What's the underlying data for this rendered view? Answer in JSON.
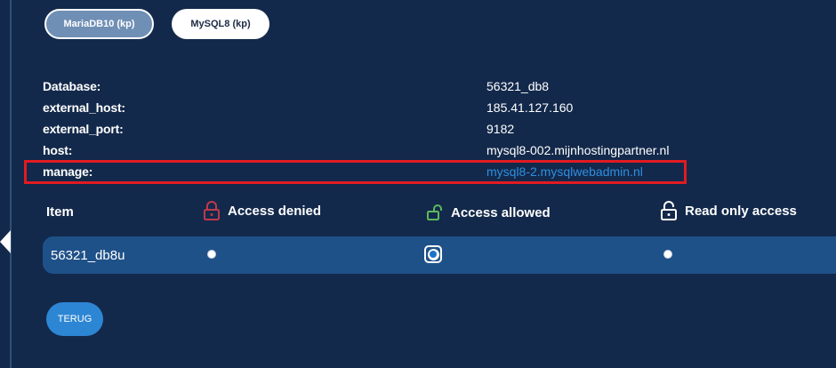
{
  "tabs": [
    {
      "label": "MariaDB10 (kp)",
      "active": true
    },
    {
      "label": "MySQL8 (kp)",
      "active": false
    }
  ],
  "info": {
    "rows": [
      {
        "key": "Database:",
        "value": "56321_db8"
      },
      {
        "key": "external_host:",
        "value": "185.41.127.160"
      },
      {
        "key": "external_port:",
        "value": "9182"
      },
      {
        "key": "host:",
        "value": "mysql8-002.mijnhostingpartner.nl"
      },
      {
        "key": "manage:",
        "value": "mysql8-2.mysqlwebadmin.nl"
      }
    ]
  },
  "access": {
    "col_item": "Item",
    "col_denied": "Access denied",
    "col_allowed": "Access allowed",
    "col_readonly": "Read only access",
    "rows": [
      {
        "item": "56321_db8u",
        "selected": "allowed"
      }
    ]
  },
  "colors": {
    "background": "#13294b",
    "row_bg": "#1f5189",
    "highlight": "#e11b22",
    "link": "#2f8fe0",
    "lock_denied": "#c0394a",
    "lock_allowed": "#5cb85c",
    "lock_readonly": "#ffffff"
  },
  "icons": {
    "denied": "lock-closed-icon",
    "allowed": "lock-open-icon",
    "readonly": "lock-icon"
  },
  "buttons": {
    "back_label": "TERUG"
  }
}
